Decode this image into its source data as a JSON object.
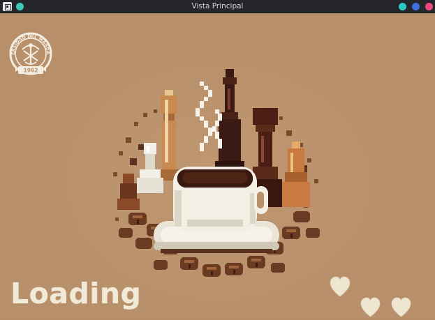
{
  "window": {
    "title": "Vista Principal",
    "colors": {
      "titlebar": "#25262b",
      "app_icon": "#e8e8ea",
      "pin": "#3ec9b6",
      "minimize": "#2cc7c4",
      "maximize": "#3f6fe0",
      "close": "#ee4a7c"
    }
  },
  "content": {
    "background_color": "#b8906a",
    "logo": {
      "icon": "university-seal-icon",
      "text_top": "UNIVERSIDAD DEL MAGDALENA",
      "text_bottom": "1962"
    },
    "illustration": {
      "icon": "coffee-cup-with-chess-pieces-illustration"
    },
    "loading_label": "Loading",
    "loading_color": "#f2ead8",
    "hearts": {
      "count": 3,
      "icon": "heart-icon",
      "color": "#efe6d2"
    }
  }
}
